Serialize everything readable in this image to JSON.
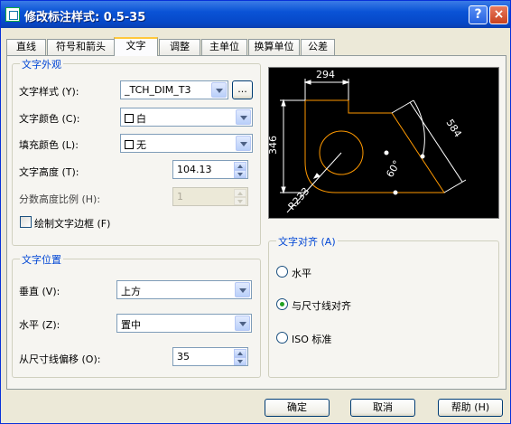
{
  "window": {
    "title": "修改标注样式: 0.5-35",
    "help_btn": "?",
    "close_btn": "×"
  },
  "tabs": [
    "直线",
    "符号和箭头",
    "文字",
    "调整",
    "主单位",
    "换算单位",
    "公差"
  ],
  "text_appearance": {
    "group_label": "文字外观",
    "style_label": "文字样式 (Y):",
    "style_value": "_TCH_DIM_T3",
    "browse_label": "...",
    "color_label": "文字颜色 (C):",
    "color_value": "白",
    "fill_label": "填充颜色 (L):",
    "fill_value": "无",
    "height_label": "文字高度 (T):",
    "height_value": "104.13",
    "fraction_label": "分数高度比例 (H):",
    "fraction_value": "1",
    "frame_label": "绘制文字边框 (F)"
  },
  "preview": {
    "dim_top": "294",
    "dim_left": "346",
    "dim_diag": "584",
    "angle": "60°",
    "radius": "R233"
  },
  "text_position": {
    "group_label": "文字位置",
    "vertical_label": "垂直 (V):",
    "vertical_value": "上方",
    "horizontal_label": "水平 (Z):",
    "horizontal_value": "置中",
    "offset_label": "从尺寸线偏移 (O):",
    "offset_value": "35"
  },
  "text_alignment": {
    "group_label": "文字对齐 (A)",
    "options": [
      "水平",
      "与尺寸线对齐",
      "ISO 标准"
    ],
    "selected": "与尺寸线对齐"
  },
  "buttons": {
    "ok": "确定",
    "cancel": "取消",
    "help": "帮助 (H)"
  },
  "colors": {
    "title_bar": "#0a53d6",
    "group_label": "#0046d5",
    "preview_bg": "#000000",
    "preview_geometry": "#ff9900",
    "preview_dims": "#ffffff"
  }
}
